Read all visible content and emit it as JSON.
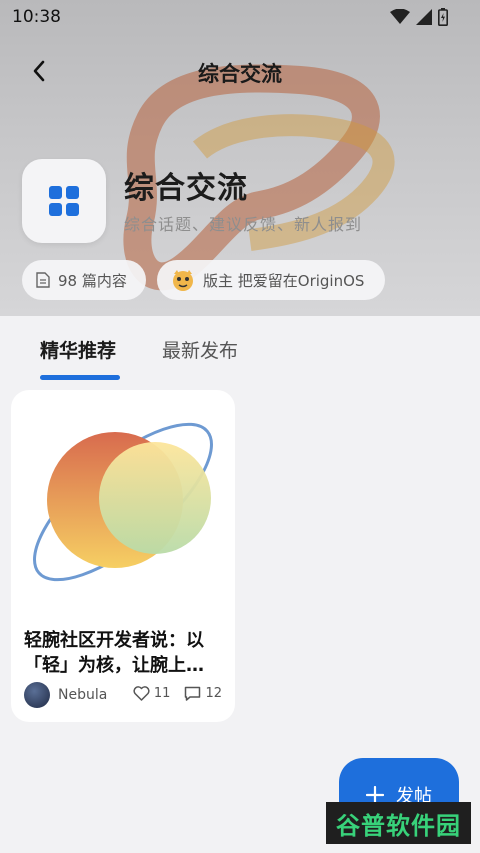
{
  "status_bar": {
    "time": "10:38"
  },
  "nav": {
    "title": "综合交流"
  },
  "forum": {
    "name": "综合交流",
    "description": "综合话题、建议反馈、新人报到",
    "posts_count": "98 篇内容",
    "moderator": "版主 把爱留在OriginOS"
  },
  "tabs": [
    {
      "label": "精华推荐",
      "active": true
    },
    {
      "label": "最新发布",
      "active": false
    }
  ],
  "post": {
    "title": "轻腕社区开发者说：以「轻」为核，让腕上…",
    "author": "Nebula",
    "likes": "11",
    "comments": "12"
  },
  "fab": {
    "label": "发帖"
  },
  "watermark": {
    "text": "谷普软件园"
  },
  "colors": {
    "accent": "#1e6fdc"
  }
}
